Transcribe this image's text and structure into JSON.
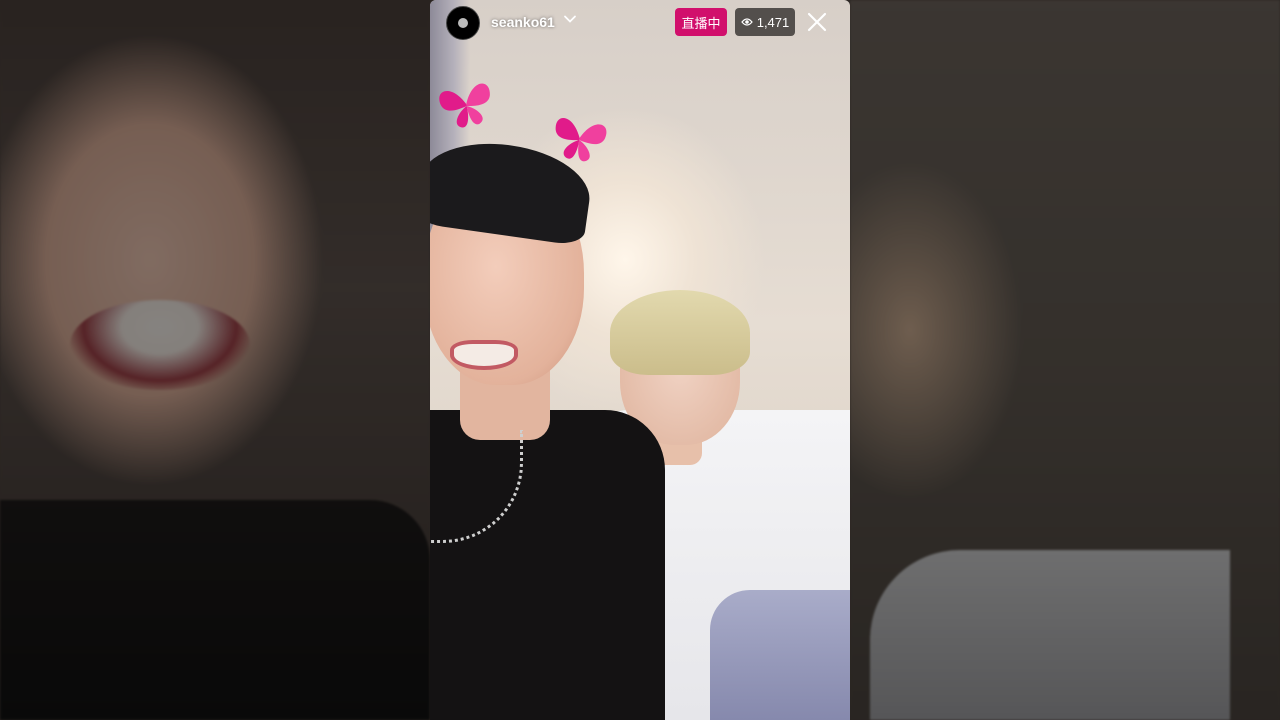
{
  "stream": {
    "username": "seanko61",
    "live_label": "直播中",
    "viewer_count": "1,471"
  },
  "icons": {
    "chevron": "chevron-down-icon",
    "viewers": "eye-icon",
    "close": "close-icon",
    "filter": "butterfly-icon"
  },
  "colors": {
    "live_badge": "#d10f6c",
    "viewer_badge": "#3c3836",
    "butterfly": "#e11b8a"
  }
}
